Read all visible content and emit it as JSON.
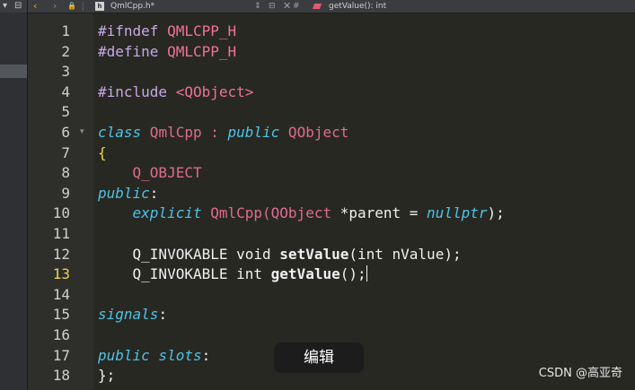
{
  "toolbar": {
    "file_name": "QmlCpp.h*",
    "file_icon_label": "h",
    "hash_symbol": "#",
    "function_selector": "getValue(): int",
    "close_glyph": "✕",
    "split_glyph": "⊟",
    "prev_glyph": "‹",
    "next_glyph": "›",
    "lock_glyph": "🔒",
    "combo_glyph": "⇕"
  },
  "left_pane": {
    "dropdown_glyph": "▾",
    "split_glyph": "⊟"
  },
  "editor": {
    "current_line": 13,
    "line_numbers": [
      "1",
      "2",
      "3",
      "4",
      "5",
      "6",
      "7",
      "8",
      "9",
      "10",
      "11",
      "12",
      "13",
      "14",
      "15",
      "16",
      "17",
      "18"
    ],
    "fold_glyph": "▾",
    "lines": [
      [
        {
          "t": "#ifndef ",
          "c": "pp"
        },
        {
          "t": "QMLCPP_H",
          "c": "macro"
        }
      ],
      [
        {
          "t": "#define ",
          "c": "pp"
        },
        {
          "t": "QMLCPP_H",
          "c": "macro"
        }
      ],
      [],
      [
        {
          "t": "#include ",
          "c": "pp"
        },
        {
          "t": "<QObject>",
          "c": "macro"
        }
      ],
      [],
      [
        {
          "t": "class",
          "c": "kw"
        },
        {
          "t": " QmlCpp : ",
          "c": "ty"
        },
        {
          "t": "public",
          "c": "kw"
        },
        {
          "t": " QObject",
          "c": "ty"
        }
      ],
      [
        {
          "t": "{",
          "c": "br"
        }
      ],
      [
        {
          "t": "    "
        },
        {
          "t": "Q_OBJECT",
          "c": "ty"
        }
      ],
      [
        {
          "t": "public",
          "c": "kw"
        },
        {
          "t": ":"
        }
      ],
      [
        {
          "t": "    "
        },
        {
          "t": "explicit",
          "c": "kw"
        },
        {
          "t": " QmlCpp(QObject ",
          "c": "ty"
        },
        {
          "t": "*parent = "
        },
        {
          "t": "nullptr",
          "c": "kw"
        },
        {
          "t": ");"
        }
      ],
      [],
      [
        {
          "t": "    Q_INVOKABLE void "
        },
        {
          "t": "setValue",
          "c": "fnb"
        },
        {
          "t": "(int nValue);"
        }
      ],
      [
        {
          "t": "    Q_INVOKABLE int "
        },
        {
          "t": "getValue",
          "c": "fnb"
        },
        {
          "t": "();"
        }
      ],
      [],
      [
        {
          "t": "signals",
          "c": "kw"
        },
        {
          "t": ":"
        }
      ],
      [],
      [
        {
          "t": "public slots",
          "c": "kw"
        },
        {
          "t": ":"
        }
      ],
      [
        {
          "t": "};"
        }
      ]
    ]
  },
  "tooltip": {
    "text": "编辑"
  },
  "watermark": {
    "text": "CSDN @高亚奇"
  }
}
